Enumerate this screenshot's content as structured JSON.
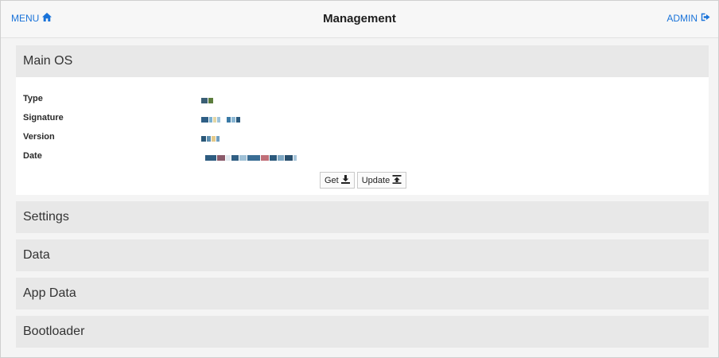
{
  "header": {
    "menu_label": "MENU",
    "title": "Management",
    "admin_label": "ADMIN"
  },
  "colors": {
    "accent": "#1a73d9",
    "section_bg": "#e8e8e8",
    "body_bg": "#ffffff"
  },
  "sections": [
    {
      "title": "Main OS",
      "expanded": true,
      "fields": [
        {
          "label": "Type"
        },
        {
          "label": "Signature"
        },
        {
          "label": "Version"
        },
        {
          "label": "Date"
        }
      ],
      "buttons": {
        "get_label": "Get",
        "update_label": "Update"
      }
    },
    {
      "title": "Settings",
      "expanded": false
    },
    {
      "title": "Data",
      "expanded": false
    },
    {
      "title": "App Data",
      "expanded": false
    },
    {
      "title": "Bootloader",
      "expanded": false
    }
  ]
}
